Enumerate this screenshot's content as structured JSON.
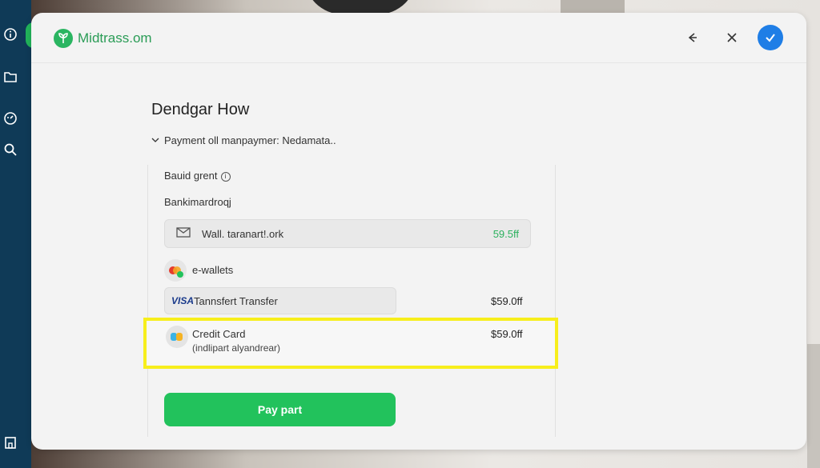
{
  "app": {
    "name": "Midtrass.om",
    "brand_color": "#2ab561"
  },
  "page": {
    "title": "Dendgar How",
    "subtitle": "Payment oll manpaymer: Nedamata.."
  },
  "panel": {
    "section1_label": "Bauid grent",
    "section2_label": "Bankimardroqj",
    "wallet_row": {
      "label": "Wall. taranart!.ork",
      "amount": "59.5ff"
    },
    "ewallets_label": "e-wallets",
    "transfer_row": {
      "brand": "VISA",
      "label": "Tannsfert Transfer",
      "amount": "$59.0ff"
    },
    "credit_card": {
      "title": "Credit Card",
      "subtitle": "(indlipart alyandrear)",
      "amount": "$59.0ff"
    },
    "pay_button": "Pay part"
  },
  "icons": {
    "sidebar": [
      "info-icon",
      "folder-icon",
      "dashboard-icon",
      "search-icon",
      "building-icon"
    ],
    "topbar": [
      "back-arrow-icon",
      "close-icon",
      "check-icon"
    ]
  },
  "colors": {
    "sidebar": "#0f3a57",
    "accent_green": "#22c25c",
    "confirm_blue": "#1f7ee6",
    "highlight": "#f7ee1c"
  }
}
